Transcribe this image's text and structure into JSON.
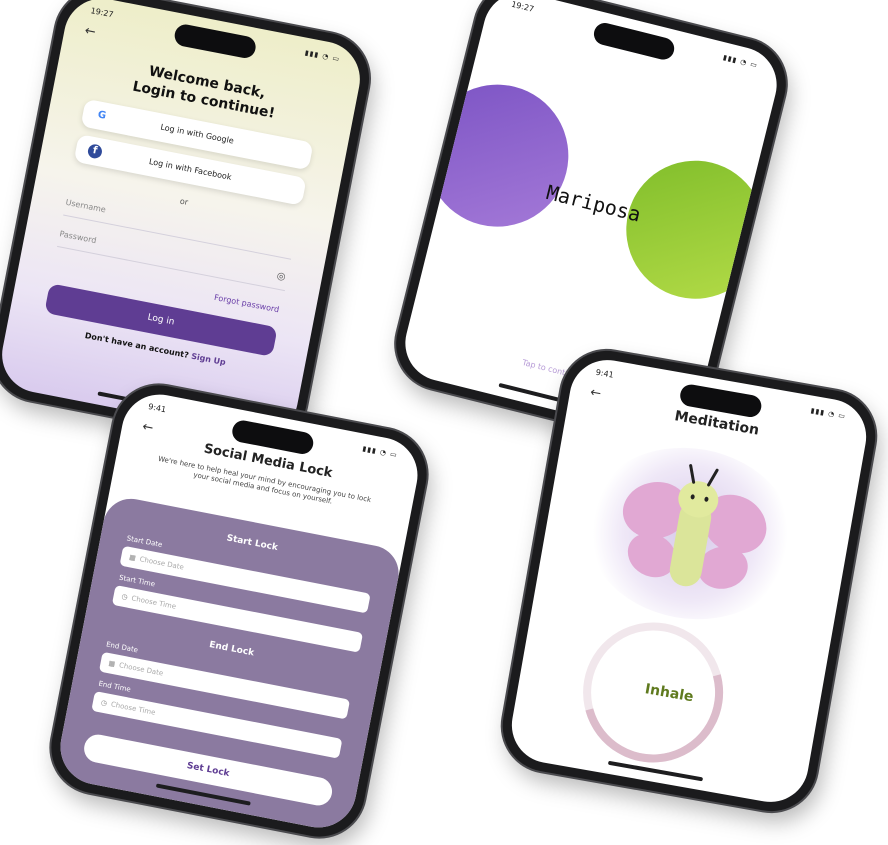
{
  "phone_login": {
    "status_time": "19:27",
    "title_line1": "Welcome back,",
    "title_line2": "Login to continue!",
    "google_label": "Log in with Google",
    "facebook_label": "Log in with Facebook",
    "or_label": "or",
    "username_placeholder": "Username",
    "password_placeholder": "Password",
    "forgot_label": "Forgot password",
    "login_label": "Log in",
    "no_account_label": "Don't have an account?",
    "signup_label": "Sign Up"
  },
  "phone_splash": {
    "status_time": "19:27",
    "logo_text": "Mariposa",
    "tap_label": "Tap to continue",
    "colors": {
      "purple": "#7b53c4",
      "green": "#8cc63f"
    }
  },
  "phone_lock": {
    "status_time": "9:41",
    "title": "Social Media Lock",
    "description": "We're here to help heal your mind by encouraging you to lock your social media and focus on yourself.",
    "start_section": "Start Lock",
    "start_date_label": "Start Date",
    "start_date_placeholder": "Choose Date",
    "start_time_label": "Start Time",
    "start_time_placeholder": "Choose Time",
    "end_section": "End Lock",
    "end_date_label": "End Date",
    "end_date_placeholder": "Choose Date",
    "end_time_label": "End Time",
    "end_time_placeholder": "Choose Time",
    "set_label": "Set Lock",
    "colors": {
      "panel": "#8b7aa0"
    }
  },
  "phone_meditation": {
    "status_time": "9:41",
    "title": "Meditation",
    "breath_label": "Inhale",
    "progress": 0.7
  }
}
